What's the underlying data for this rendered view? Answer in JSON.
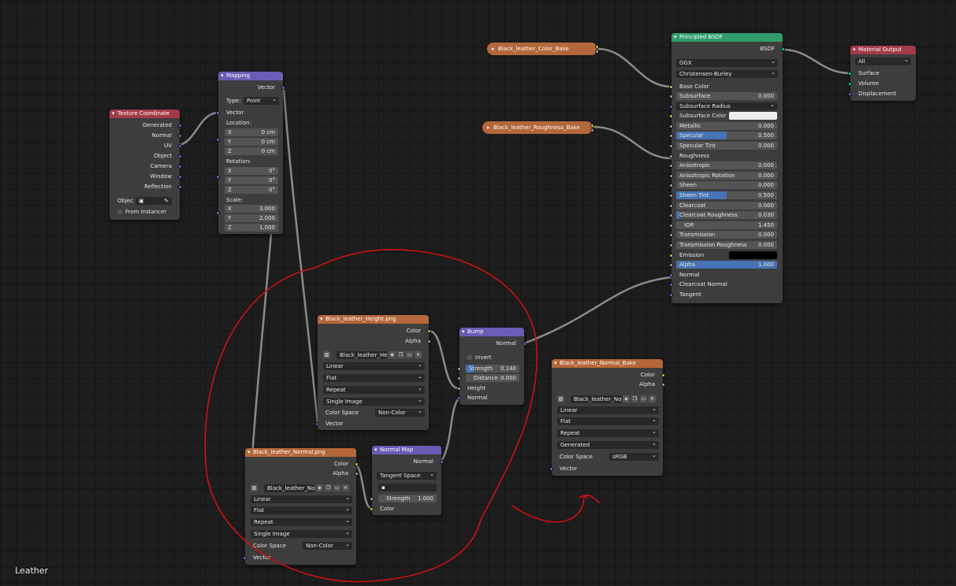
{
  "editor": {
    "label": "Leather"
  },
  "colors": {
    "input": "#a33a4a",
    "vector": "#6b5bb5",
    "shader": "#2f9c6a",
    "texture": "#b4673a",
    "output": "#a33a4a",
    "annotation": "#cc1010"
  },
  "texture_coordinate": {
    "title": "Texture Coordinate",
    "outputs": [
      "Generated",
      "Normal",
      "UV",
      "Object",
      "Camera",
      "Window",
      "Reflection"
    ],
    "object_label": "Objec",
    "from_instancer": "From Instancer"
  },
  "mapping": {
    "title": "Mapping",
    "out_vector": "Vector",
    "type_label": "Type:",
    "type_value": "Point",
    "in_vector": "Vector",
    "location_label": "Location:",
    "location": [
      {
        "a": "X",
        "v": "0 cm"
      },
      {
        "a": "Y",
        "v": "0 cm"
      },
      {
        "a": "Z",
        "v": "0 cm"
      }
    ],
    "rotation_label": "Rotation:",
    "rotation": [
      {
        "a": "X",
        "v": "0°"
      },
      {
        "a": "Y",
        "v": "0°"
      },
      {
        "a": "Z",
        "v": "0°"
      }
    ],
    "scale_label": "Scale:",
    "scale": [
      {
        "a": "X",
        "v": "3.000"
      },
      {
        "a": "Y",
        "v": "2.000"
      },
      {
        "a": "Z",
        "v": "1.000"
      }
    ]
  },
  "reroute_color": {
    "title": "Black_leather_Color_Bake"
  },
  "reroute_rough": {
    "title": "Black_leather_Roughness_Bake"
  },
  "principled": {
    "title": "Principled BSDF",
    "out": "BSDF",
    "distribution": "GGX",
    "subsurface_method": "Christensen-Burley",
    "base_color": "Base Color",
    "fields": [
      {
        "name": "Subsurface",
        "value": "0.000",
        "fill": 0
      },
      {
        "name": "Subsurface Radius",
        "value": "",
        "fill": 0,
        "select": true
      },
      {
        "name": "Subsurface Color",
        "value": "",
        "fill": 0,
        "swatch": "#eeeeee"
      },
      {
        "name": "Metallic",
        "value": "0.000",
        "fill": 0
      },
      {
        "name": "Specular",
        "value": "0.500",
        "fill": 0.5
      },
      {
        "name": "Specular Tint",
        "value": "0.000",
        "fill": 0
      },
      {
        "name": "Roughness",
        "value": "",
        "fill": 0,
        "plain": true
      },
      {
        "name": "Anisotropic",
        "value": "0.000",
        "fill": 0
      },
      {
        "name": "Anisotropic Rotation",
        "value": "0.000",
        "fill": 0
      },
      {
        "name": "Sheen",
        "value": "0.000",
        "fill": 0
      },
      {
        "name": "Sheen Tint",
        "value": "0.500",
        "fill": 0.5
      },
      {
        "name": "Clearcoat",
        "value": "0.000",
        "fill": 0
      },
      {
        "name": "Clearcoat Roughness",
        "value": "0.030",
        "fill": 0.03
      },
      {
        "name": "IOR",
        "value": "1.450",
        "fill": 0,
        "center": true
      },
      {
        "name": "Transmission",
        "value": "0.000",
        "fill": 0
      },
      {
        "name": "Transmission Roughness",
        "value": "0.000",
        "fill": 0
      },
      {
        "name": "Emission",
        "value": "",
        "fill": 0,
        "swatch": "#000000"
      },
      {
        "name": "Alpha",
        "value": "1.000",
        "fill": 1
      },
      {
        "name": "Normal",
        "value": "",
        "fill": 0,
        "plain": true
      },
      {
        "name": "Clearcoat Normal",
        "value": "",
        "fill": 0,
        "plain": true
      },
      {
        "name": "Tangent",
        "value": "",
        "fill": 0,
        "plain": true
      }
    ]
  },
  "material_output": {
    "title": "Material Output",
    "target": "All",
    "inputs": [
      "Surface",
      "Volume",
      "Displacement"
    ]
  },
  "height_tex": {
    "title": "Black_leather_Height.png",
    "outputs": [
      "Color",
      "Alpha"
    ],
    "image": "Black_leather_Hei...",
    "interp": "Linear",
    "proj": "Flat",
    "ext": "Repeat",
    "source": "Single Image",
    "cs_label": "Color Space",
    "cs_value": "Non-Color",
    "in_vector": "Vector"
  },
  "bump": {
    "title": "Bump",
    "out": "Normal",
    "invert": "Invert",
    "strength_label": "Strength",
    "strength": "0.140",
    "distance_label": "Distance",
    "distance": "0.000",
    "height": "Height",
    "normal": "Normal"
  },
  "normal_bake": {
    "title": "Black_leather_Normal_Bake",
    "outputs": [
      "Color",
      "Alpha"
    ],
    "image": "Black_leather_Nor...",
    "interp": "Linear",
    "proj": "Flat",
    "ext": "Repeat",
    "source": "Generated",
    "cs_label": "Color Space",
    "cs_value": "sRGB",
    "in_vector": "Vector"
  },
  "normal_tex": {
    "title": "Black_leather_Normal.png",
    "outputs": [
      "Color",
      "Alpha"
    ],
    "image": "Black_leather_Nor...",
    "interp": "Linear",
    "proj": "Flat",
    "ext": "Repeat",
    "source": "Single Image",
    "cs_label": "Color Space",
    "cs_value": "Non-Color",
    "in_vector": "Vector"
  },
  "normal_map": {
    "title": "Normal Map",
    "out": "Normal",
    "space": "Tangent Space",
    "uv": "",
    "strength_label": "Strength",
    "strength": "1.000",
    "color": "Color"
  }
}
